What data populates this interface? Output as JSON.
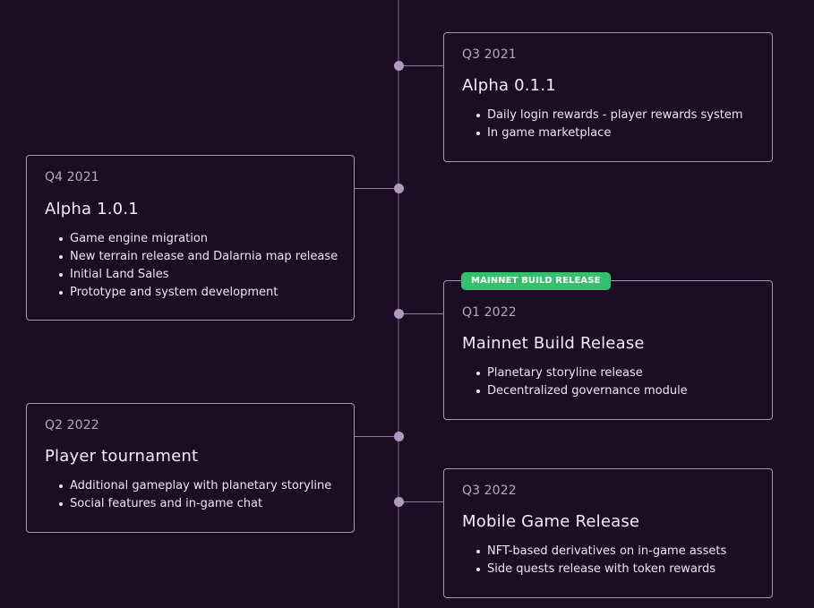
{
  "roadmap": {
    "items": [
      {
        "quarter": "Q3 2021",
        "title": "Alpha 0.1.1",
        "bullets": [
          "Daily login rewards - player rewards system",
          "In game marketplace"
        ]
      },
      {
        "quarter": "Q4 2021",
        "title": "Alpha 1.0.1",
        "bullets": [
          "Game engine migration",
          "New terrain release and Dalarnia map release",
          "Initial Land Sales",
          "Prototype and system development"
        ]
      },
      {
        "badge": "MAINNET BUILD RELEASE",
        "quarter": "Q1 2022",
        "title": "Mainnet Build Release",
        "bullets": [
          "Planetary storyline release",
          "Decentralized governance module"
        ]
      },
      {
        "quarter": "Q2 2022",
        "title": "Player tournament",
        "bullets": [
          "Additional gameplay with planetary storyline",
          "Social features and in-game chat"
        ]
      },
      {
        "quarter": "Q3 2022",
        "title": "Mobile Game Release",
        "bullets": [
          "NFT-based derivatives on in-game assets",
          "Side quests release with token rewards"
        ]
      }
    ]
  },
  "colors": {
    "background": "#1c0d24",
    "card_border": "#a893bb",
    "node": "#b09ac0",
    "badge": "#34c06d"
  }
}
